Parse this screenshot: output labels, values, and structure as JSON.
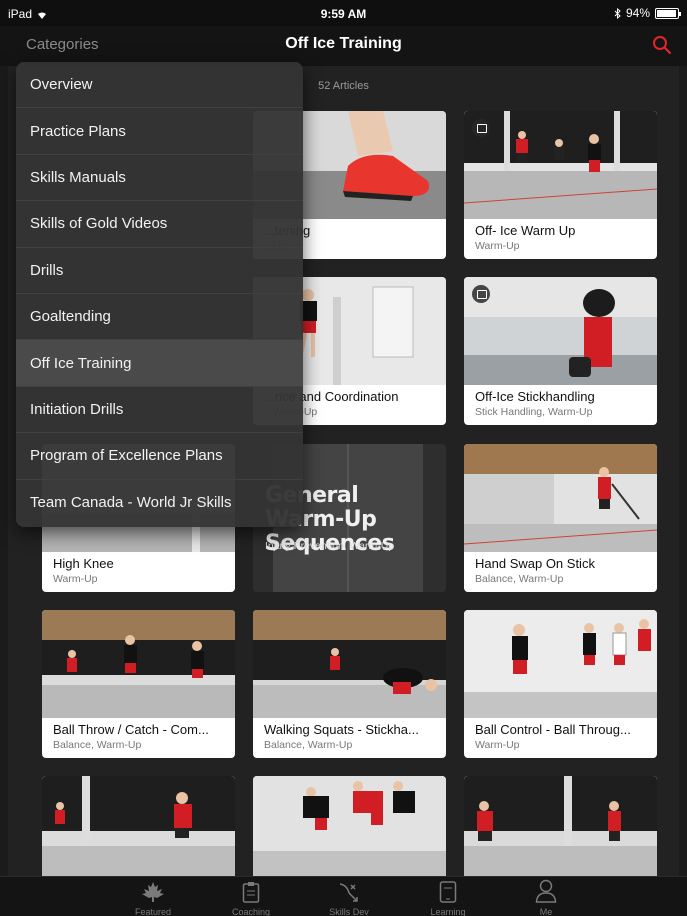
{
  "status_bar": {
    "device": "iPad",
    "time": "9:59 AM",
    "battery": "94%",
    "battery_level": 0.94
  },
  "nav": {
    "categories_label": "Categories",
    "title": "Off Ice Training"
  },
  "content": {
    "article_count": "52 Articles"
  },
  "cards": [
    {
      "title": "...tening",
      "subtitle": "...Up"
    },
    {
      "title": "Off- Ice Warm Up",
      "subtitle": "Warm-Up",
      "video": true
    },
    {
      "title": "...nce and Coordination",
      "subtitle": "...Warm-Up"
    },
    {
      "title": "Off-Ice Stickhandling",
      "subtitle": "Stick Handling, Warm-Up",
      "video": true
    },
    {
      "title": "High Knee",
      "subtitle": "Warm-Up"
    },
    {
      "title": "General Warm-Up Sequences",
      "subtitle": "Injury Prevention, Warm-Up"
    },
    {
      "title": "Hand Swap On Stick",
      "subtitle": "Balance, Warm-Up"
    },
    {
      "title": "Ball Throw / Catch - Com...",
      "subtitle": "Balance, Warm-Up"
    },
    {
      "title": "Walking Squats - Stickha...",
      "subtitle": "Balance, Warm-Up"
    },
    {
      "title": "Ball Control - Ball Throug...",
      "subtitle": "Warm-Up"
    }
  ],
  "dropdown": {
    "items": [
      {
        "label": "Overview"
      },
      {
        "label": "Practice Plans"
      },
      {
        "label": "Skills Manuals"
      },
      {
        "label": "Skills of Gold Videos"
      },
      {
        "label": "Drills"
      },
      {
        "label": "Goaltending"
      },
      {
        "label": "Off Ice Training",
        "selected": true
      },
      {
        "label": "Initiation Drills"
      },
      {
        "label": "Program of Excellence Plans"
      },
      {
        "label": "Team Canada - World Jr Skills"
      }
    ]
  },
  "tabs": [
    {
      "label": "Featured",
      "icon": "maple-leaf-icon"
    },
    {
      "label": "Coaching",
      "icon": "clipboard-icon"
    },
    {
      "label": "Skills Dev",
      "icon": "play-diagram-icon"
    },
    {
      "label": "Learning",
      "icon": "tablet-icon"
    },
    {
      "label": "Me",
      "icon": "person-icon"
    }
  ],
  "colors": {
    "accent": "#e0262c",
    "background": "#222222",
    "card": "#ffffff",
    "jersey_red": "#d11d24"
  }
}
